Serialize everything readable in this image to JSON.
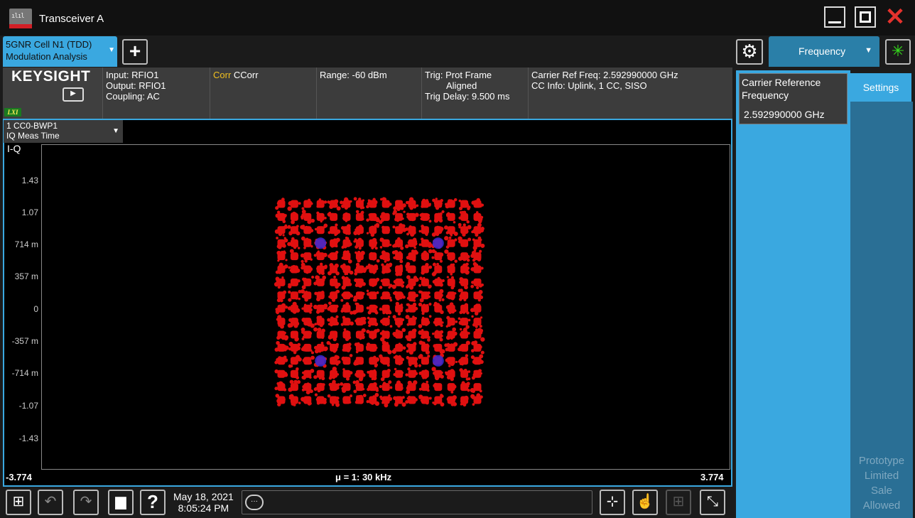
{
  "window": {
    "title": "Transceiver A"
  },
  "tabs": {
    "mode_line1": "5GNR Cell N1 (TDD)",
    "mode_line2": "Modulation Analysis",
    "add": "+"
  },
  "menu": {
    "active": "Frequency"
  },
  "status": {
    "brand": "KEYSIGHT",
    "lxi": "LXI",
    "input": "Input: RFIO1",
    "output": "Output: RFIO1",
    "coupling": "Coupling: AC",
    "corr_prefix": "Corr",
    "corr_value": "CCorr",
    "range": "Range: -60 dBm",
    "trig_line1": "Trig: Prot Frame",
    "trig_line2": "Aligned",
    "trig_delay": "Trig Delay: 9.500 ms",
    "carrier_ref": "Carrier Ref Freq: 2.592990000 GHz",
    "cc_info": "CC Info: Uplink, 1 CC, SISO"
  },
  "display": {
    "window_line1": "1 CC0-BWP1",
    "window_line2": "IQ Meas Time",
    "title": "I-Q",
    "y_ticks": [
      "1.43",
      "1.07",
      "714 m",
      "357 m",
      "0",
      "-357 m",
      "-714 m",
      "-1.07",
      "-1.43"
    ],
    "x_left": "-3.774",
    "x_right": "3.774",
    "x_center": "μ = 1: 30 kHz",
    "constellation": {
      "grid_size": 16,
      "point_color": "#e01010",
      "marker_color": "#3a2ad8"
    }
  },
  "panel": {
    "label": "Carrier Reference\nFrequency",
    "value": "2.592990000 GHz",
    "settings": "Settings",
    "watermark": "Prototype\nLimited\nSale\nAllowed"
  },
  "taskbar": {
    "date": "May 18, 2021",
    "time": "8:05:24 PM",
    "help": "?"
  }
}
